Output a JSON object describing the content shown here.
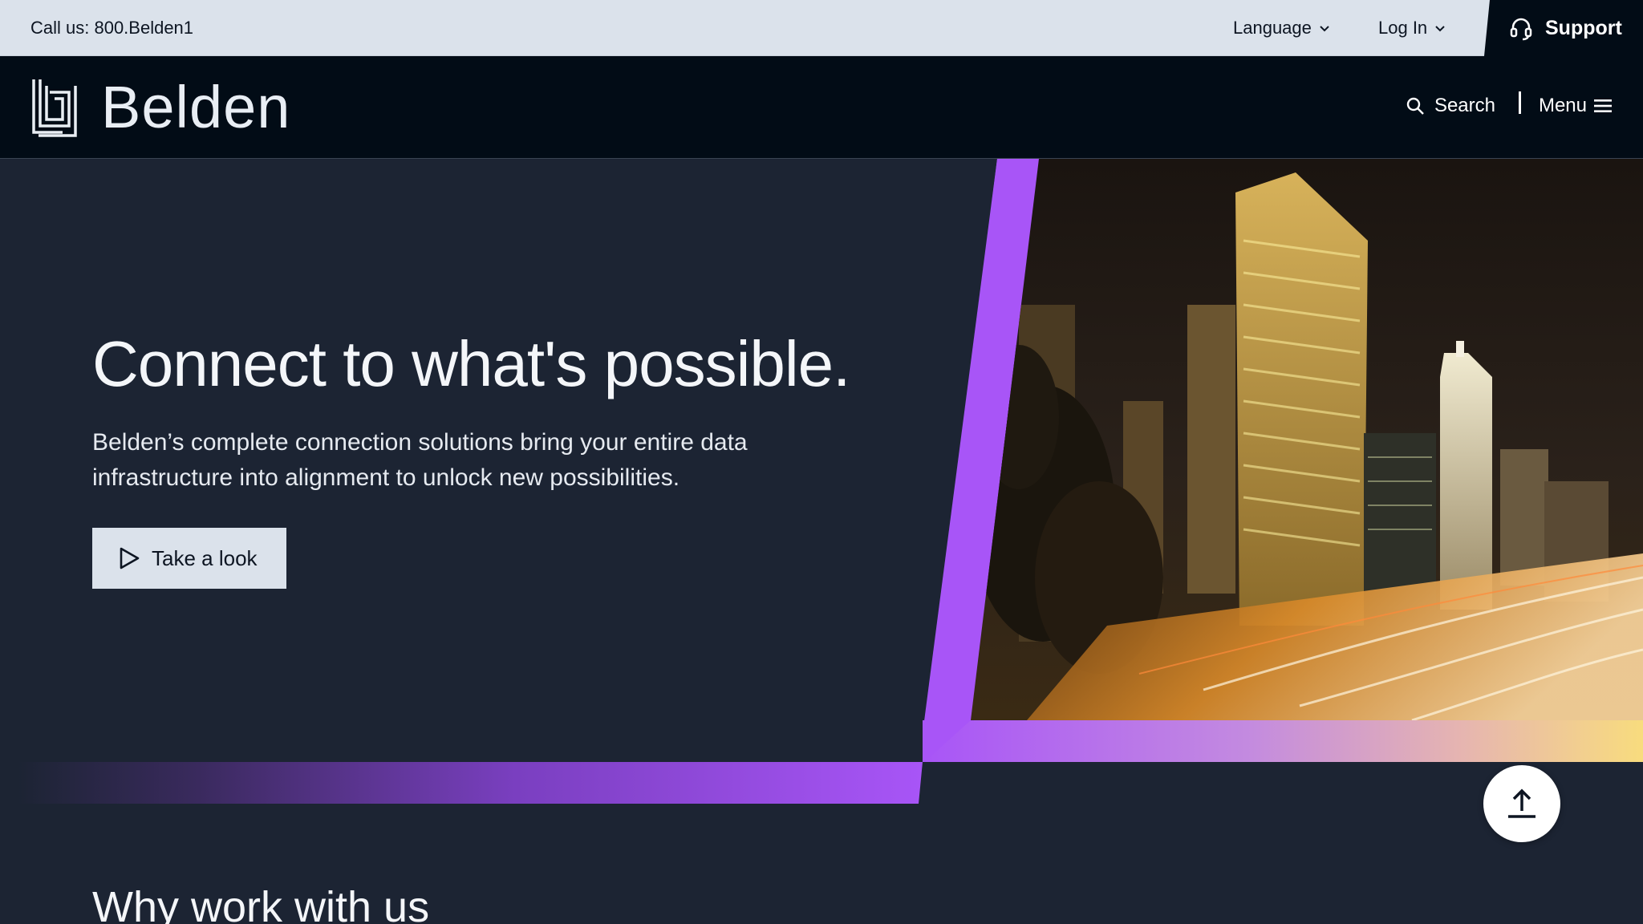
{
  "topbar": {
    "call_us": "Call us: 800.Belden1",
    "language": "Language",
    "login": "Log In",
    "support": "Support"
  },
  "header": {
    "logo_text": "Belden",
    "search": "Search",
    "menu": "Menu"
  },
  "hero": {
    "title": "Connect to what's possible.",
    "subtitle": "Belden’s complete connection solutions bring your entire data infrastructure into alignment to unlock new possibilities.",
    "cta": "Take a look"
  },
  "sections": {
    "why_title": "Why work with us"
  },
  "icons": {
    "language_chevron": "chevron-down-icon",
    "login_chevron": "chevron-down-icon",
    "support": "headset-icon",
    "search": "search-icon",
    "menu": "hamburger-icon",
    "cta": "play-icon",
    "to_top": "arrow-up-icon",
    "logo": "belden-logo-icon"
  },
  "colors": {
    "accent_purple": "#a855f7",
    "navy": "#1c2433",
    "header_black": "#020c16",
    "light_gray": "#dbe2eb",
    "gold": "#f8dc7e"
  }
}
